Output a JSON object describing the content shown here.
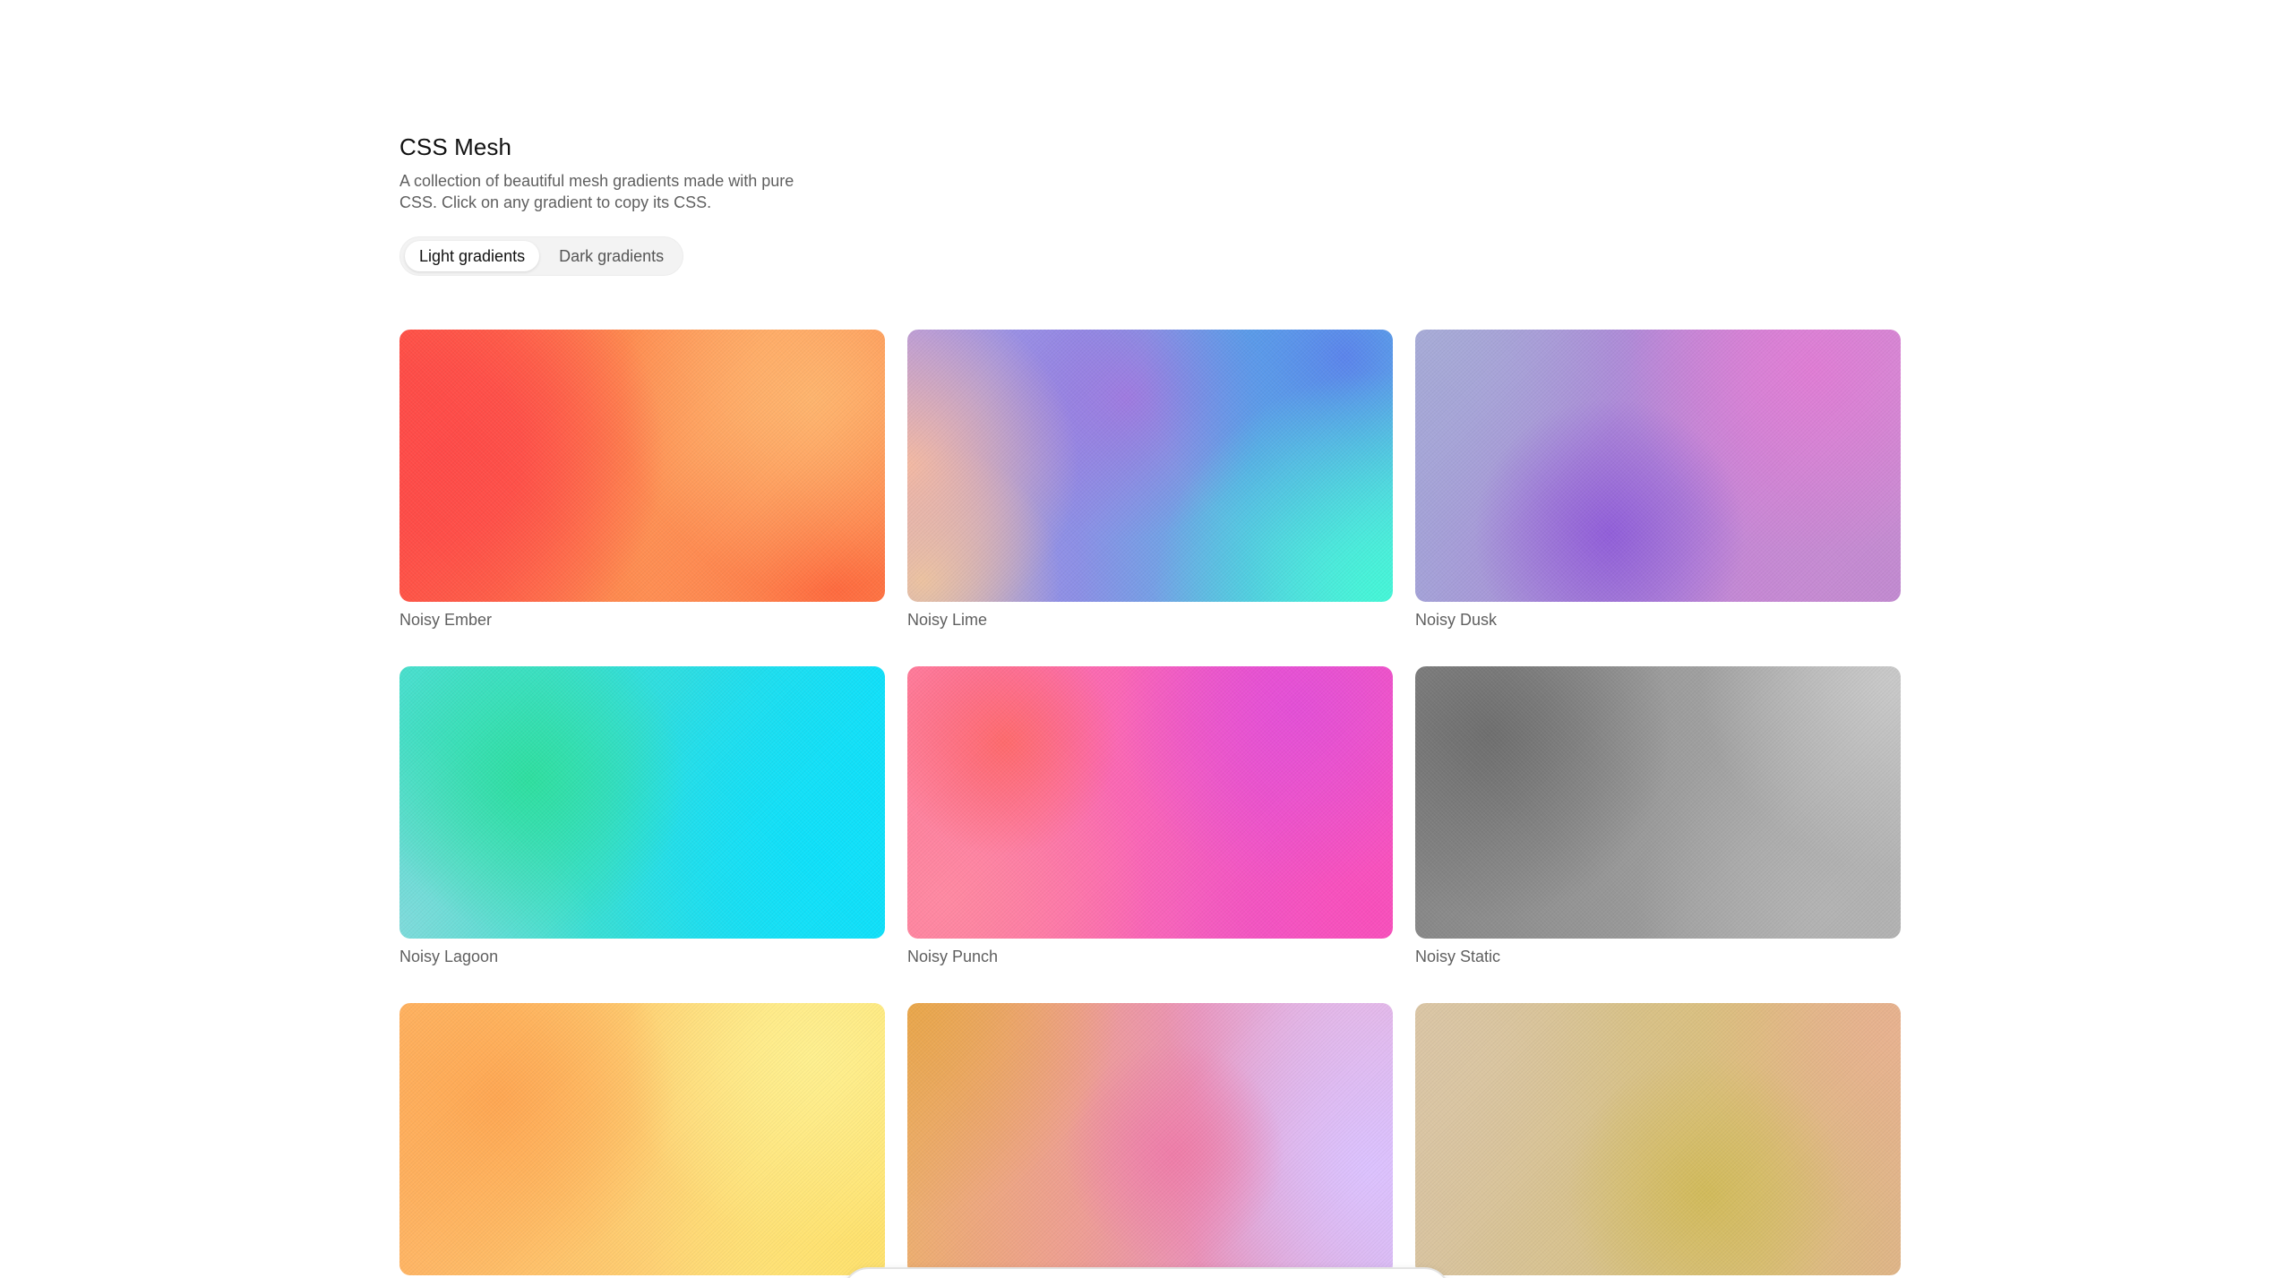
{
  "header": {
    "title": "CSS Mesh",
    "description": "A collection of beautiful mesh gradients made with pure CSS. Click on any gradient to copy its CSS."
  },
  "toggle": {
    "selected": "Light gradients",
    "options": [
      "Light gradients",
      "Dark gradients"
    ]
  },
  "gradients": [
    {
      "name": "Noisy Ember",
      "colors": [
        "#ff4a48",
        "#ff8a4f",
        "#ffb56e"
      ]
    },
    {
      "name": "Noisy Lime",
      "colors": [
        "#f3b9a2",
        "#9f7ae0",
        "#5b84ec",
        "#45f7d8"
      ]
    },
    {
      "name": "Noisy Dusk",
      "colors": [
        "#a7abd7",
        "#915ed9",
        "#e07dd5"
      ]
    },
    {
      "name": "Noisy Lagoon",
      "colors": [
        "#2edf9f",
        "#7edbdb",
        "#0ee1fb"
      ]
    },
    {
      "name": "Noisy Punch",
      "colors": [
        "#ff6a6c",
        "#ff89a2",
        "#e44fd7",
        "#f94fbc"
      ]
    },
    {
      "name": "Noisy Static",
      "colors": [
        "#6e6e6e",
        "#979797",
        "#c9c9c9"
      ]
    },
    {
      "name": "",
      "colors": [
        "#ffa752",
        "#ffc86d",
        "#fff08f"
      ]
    },
    {
      "name": "",
      "colors": [
        "#e9a64a",
        "#ef7da9",
        "#dcc2ff"
      ]
    },
    {
      "name": "",
      "colors": [
        "#dbc6a5",
        "#d2bb5b",
        "#e8b28f"
      ]
    }
  ]
}
